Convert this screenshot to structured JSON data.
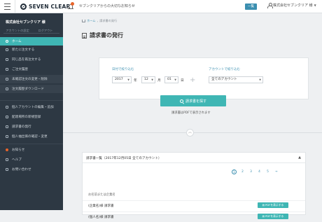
{
  "header": {
    "logo_text": "SEVEN CLEAR",
    "notice": "セブンクリアからの大切なお知らせ",
    "list_button": "一覧",
    "company_menu": "株式会社セブンクリア 様"
  },
  "sidebar": {
    "company": "株式会社セブンクリア 様",
    "tabs": [
      "アカウントの設定",
      "ログアウト"
    ],
    "items": [
      {
        "label": "ホーム"
      },
      {
        "label": "新たに注文する"
      },
      {
        "label": "同じ品を再注文する"
      },
      {
        "label": "ご注文履歴"
      },
      {
        "label": "未確認注文の変更・削除"
      },
      {
        "label": "注文履歴ダウンロード"
      },
      {
        "label": "個人アカウントの編集・追加"
      },
      {
        "label": "配達場所の新規登録"
      },
      {
        "label": "請求書の発行"
      },
      {
        "label": "個人抽出価の確認・変更"
      },
      {
        "label": "お知らせ"
      },
      {
        "label": "ヘルプ"
      },
      {
        "label": "お問い合わせ"
      }
    ]
  },
  "breadcrumb": {
    "home": "ホーム",
    "sep": "›",
    "current": "請求書の発行"
  },
  "page_title": "請求書の発行",
  "filter": {
    "date_label": "日付で絞り込む",
    "year": "2017",
    "year_unit": "年",
    "month": "12",
    "month_unit": "月",
    "day": "01",
    "day_unit": "日",
    "account_label": "アカウントで絞り込む",
    "account": "全てのアカウント"
  },
  "search_button": "請求書を探す",
  "hint": "請求書はPDFで表示されます",
  "results": {
    "title": "請求書一覧（2017年12月05日 全てのアカウント）",
    "toggle": "▲",
    "pages": [
      "1",
      "2",
      "3",
      "4",
      "5",
      "→"
    ],
    "column_header": "お名前または企業名",
    "rows": [
      {
        "name": "(企業名)様 請求書",
        "button": "PDFを表示する"
      },
      {
        "name": "(個人名)様 請求書",
        "button": "PDFを表示する"
      }
    ]
  },
  "colors": {
    "accent": "#3fb6b4",
    "sidebar_bg": "#2d3843",
    "link": "#3b8fb0",
    "badge": "#e8642a"
  }
}
